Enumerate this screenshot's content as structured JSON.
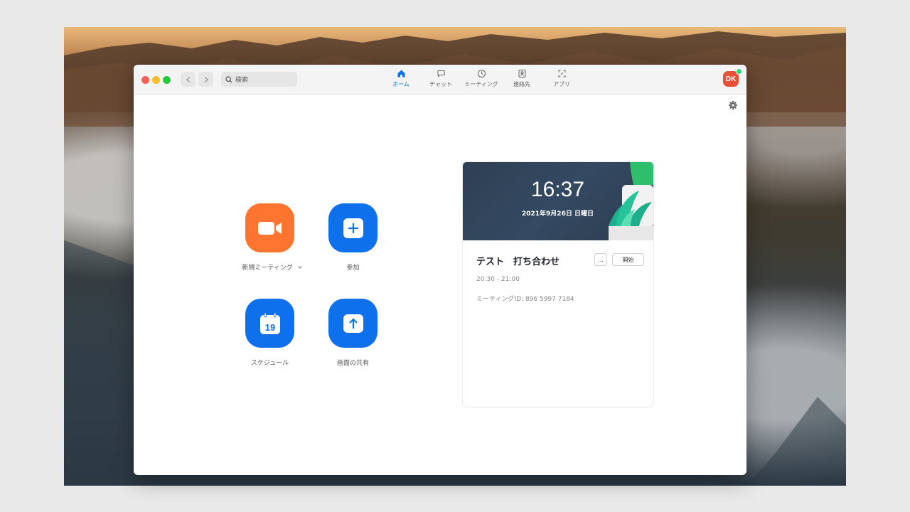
{
  "toolbar": {
    "search_placeholder": "検索"
  },
  "tabs": [
    {
      "label": "ホーム",
      "active": true,
      "icon": "home-icon"
    },
    {
      "label": "チャット",
      "active": false,
      "icon": "chat-icon"
    },
    {
      "label": "ミーティング",
      "active": false,
      "icon": "clock-icon"
    },
    {
      "label": "連絡先",
      "active": false,
      "icon": "contacts-icon"
    },
    {
      "label": "アプリ",
      "active": false,
      "icon": "apps-icon"
    }
  ],
  "user": {
    "initials": "DK",
    "status": "online"
  },
  "actions": {
    "new_meeting": {
      "label": "新規ミーティング",
      "icon": "video-camera-icon",
      "color": "#ff742e"
    },
    "join": {
      "label": "参加",
      "icon": "plus-icon",
      "color": "#0e71eb"
    },
    "schedule": {
      "label": "スケジュール",
      "icon": "calendar-icon",
      "day": "19",
      "color": "#0e71eb"
    },
    "share_screen": {
      "label": "画面の共有",
      "icon": "arrow-up-icon",
      "color": "#0e71eb"
    }
  },
  "card": {
    "time": "16:37",
    "date": "2021年9月26日 日曜日",
    "meeting_title": "テスト　打ち合わせ",
    "more_label": "...",
    "start_label": "開始",
    "meeting_time": "20:30 - 21:00",
    "meeting_id": "ミーティングID: 896 5997 7184"
  },
  "colors": {
    "accent": "#0e71eb",
    "orange": "#ff742e",
    "avatar": "#e8503a"
  }
}
